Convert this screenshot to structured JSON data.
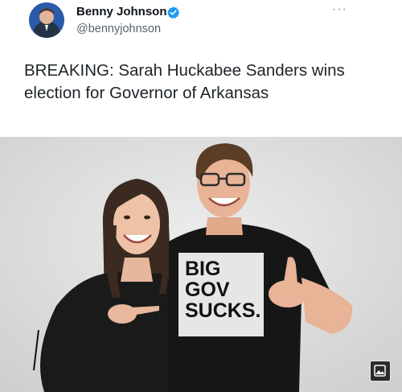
{
  "tweet": {
    "author_name": "Benny Johnson",
    "author_handle": "@bennyjohnson",
    "more_label": "···",
    "text": "BREAKING: Sarah Huckabee Sanders wins election for Governor of Arkansas"
  },
  "media": {
    "shirt_text_lines": [
      "BIG",
      "GOV",
      "SUCKS."
    ]
  },
  "icons": {
    "verified": "verified-badge-icon",
    "more": "more-options-icon",
    "media": "image-icon"
  },
  "colors": {
    "verified_blue": "#1d9bf0",
    "text": "#0f1419",
    "secondary": "#536471"
  }
}
